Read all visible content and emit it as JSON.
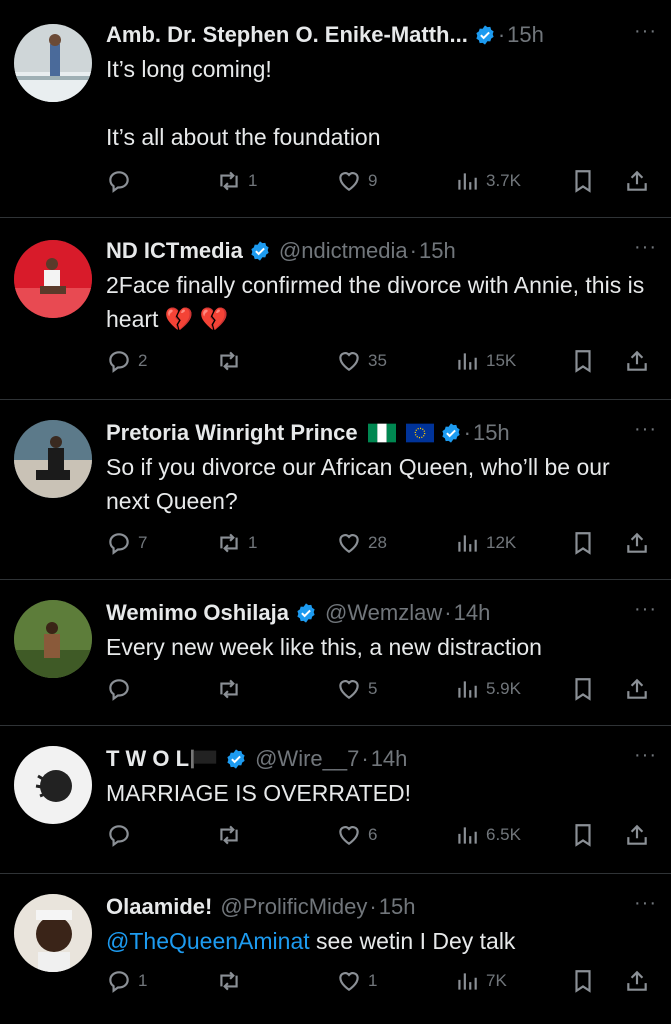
{
  "tweets": [
    {
      "name": "Amb. Dr. Stephen O. Enike-Matth...",
      "handle": "",
      "time": "15h",
      "verified": true,
      "text": "It’s long coming!\n\nIt’s all about the foundation",
      "replies": "",
      "retweets": "1",
      "likes": "9",
      "views": "3.7K"
    },
    {
      "name": "ND ICTmedia",
      "handle": "@ndictmedia",
      "time": "15h",
      "verified": true,
      "text": "2Face finally confirmed the divorce with Annie, this is heart",
      "emoji": "💔 💔",
      "replies": "2",
      "retweets": "",
      "likes": "35",
      "views": "15K"
    },
    {
      "name": "Pretoria Winright Prince",
      "handle": "",
      "time": "15h",
      "verified": true,
      "text": "So if you divorce our African Queen, who’ll be our next Queen?",
      "replies": "7",
      "retweets": "1",
      "likes": "28",
      "views": "12K"
    },
    {
      "name": "Wemimo Oshilaja",
      "handle": "@Wemzlaw",
      "time": "14h",
      "verified": true,
      "text": "Every new week like this, a new distraction",
      "replies": "",
      "retweets": "",
      "likes": "5",
      "views": "5.9K"
    },
    {
      "name": "T W O L",
      "handle": "@Wire__7",
      "time": "14h",
      "verified": true,
      "text": "MARRIAGE IS OVERRATED!",
      "replies": "",
      "retweets": "",
      "likes": "6",
      "views": "6.5K"
    },
    {
      "name": "Olaamide!",
      "handle": "@ProlificMidey",
      "time": "15h",
      "verified": false,
      "mention": "@TheQueenAminat",
      "text": " see wetin I Dey talk",
      "replies": "1",
      "retweets": "",
      "likes": "1",
      "views": "7K"
    }
  ],
  "separator": "·",
  "more_icon": "···",
  "colors": {
    "background": "#000000",
    "text": "#e7e9ea",
    "muted": "#71767b",
    "accent": "#1d9bf0",
    "divider": "#2f3336"
  },
  "icons": [
    "reply-icon",
    "retweet-icon",
    "like-icon",
    "views-icon",
    "bookmark-icon",
    "share-icon",
    "verified-icon",
    "more-icon"
  ]
}
